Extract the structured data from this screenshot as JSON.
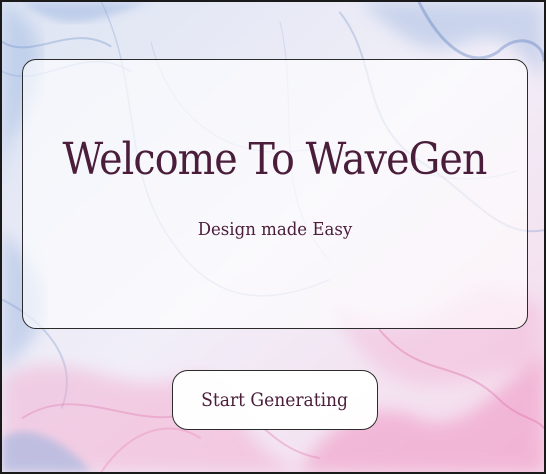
{
  "hero": {
    "title": "Welcome To WaveGen",
    "subtitle": "Design made Easy"
  },
  "cta": {
    "label": "Start Generating"
  },
  "colors": {
    "text": "#4a1d3a",
    "border": "#2b2b2b",
    "background_blue": "#8fb0dd",
    "background_pink": "#ee8fc2"
  }
}
